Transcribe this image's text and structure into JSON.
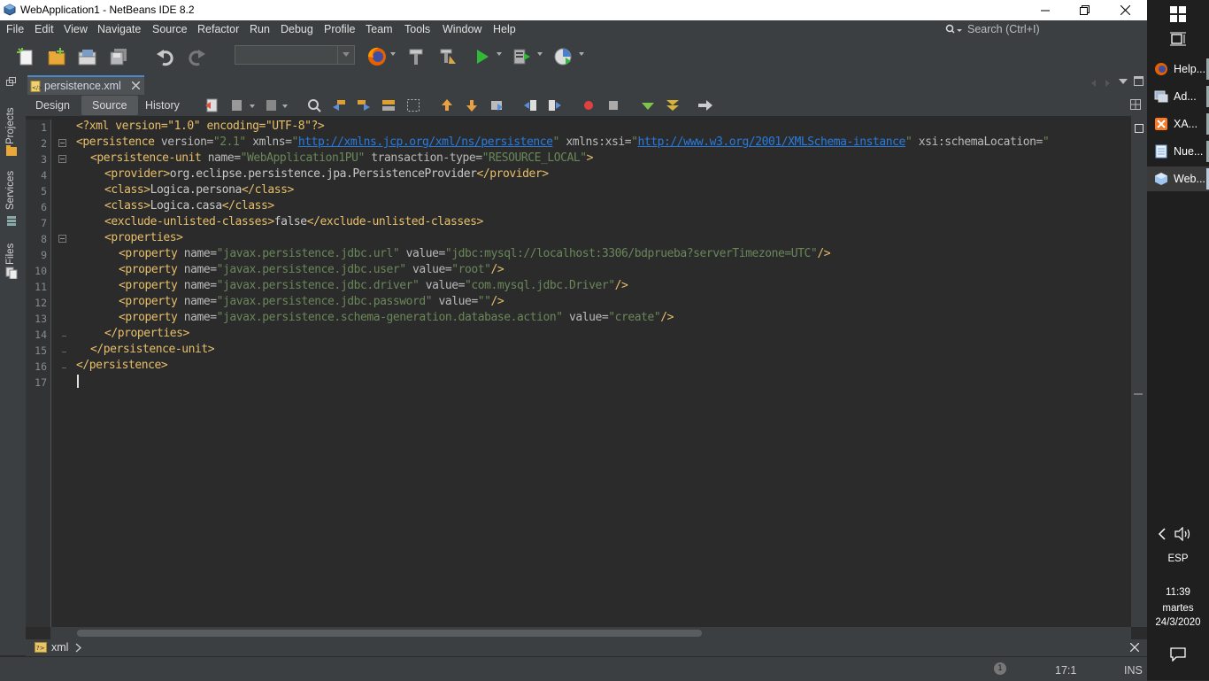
{
  "window": {
    "title": "WebApplication1 - NetBeans IDE 8.2"
  },
  "menu": [
    "File",
    "Edit",
    "View",
    "Navigate",
    "Source",
    "Refactor",
    "Run",
    "Debug",
    "Profile",
    "Team",
    "Tools",
    "Window",
    "Help"
  ],
  "search": {
    "placeholder": "Search (Ctrl+I)"
  },
  "toolbar": {
    "config_value": ""
  },
  "side_tabs": {
    "projects": "Projects",
    "services": "Services",
    "files": "Files"
  },
  "editor_tab": {
    "label": "persistence.xml"
  },
  "editor_modes": {
    "design": "Design",
    "source": "Source",
    "history": "History",
    "active": "Source"
  },
  "line_numbers": [
    "1",
    "2",
    "3",
    "4",
    "5",
    "6",
    "7",
    "8",
    "9",
    "10",
    "11",
    "12",
    "13",
    "14",
    "15",
    "16",
    "17"
  ],
  "code": {
    "l1": {
      "text": "<?xml version=\"1.0\" encoding=\"UTF-8\"?>"
    },
    "l2": {
      "open": "<persistence",
      "a1": " version=",
      "v1": "\"2.1\"",
      "a2": " xmlns=",
      "q": "\"",
      "u1": "http://xmlns.jcp.org/xml/ns/persistence",
      "a3": " xmlns:xsi=",
      "u2": "http://www.w3.org/2001/XMLSchema-instance",
      "a4": " xsi:schemaLocation=",
      "v4": "\""
    },
    "l3": {
      "open": "<persistence-unit",
      "a1": " name=",
      "v1": "\"WebApplication1PU\"",
      "a2": " transaction-type=",
      "v2": "\"RESOURCE_LOCAL\"",
      "close": ">"
    },
    "l4": {
      "open": "<provider>",
      "text": "org.eclipse.persistence.jpa.PersistenceProvider",
      "close": "</provider>"
    },
    "l5": {
      "open": "<class>",
      "text": "Logica.persona",
      "close": "</class>"
    },
    "l6": {
      "open": "<class>",
      "text": "Logica.casa",
      "close": "</class>"
    },
    "l7": {
      "open": "<exclude-unlisted-classes>",
      "text": "false",
      "close": "</exclude-unlisted-classes>"
    },
    "l8": {
      "open": "<properties>"
    },
    "l9": {
      "open": "<property",
      "a1": " name=",
      "v1": "\"javax.persistence.jdbc.url\"",
      "a2": " value=",
      "v2": "\"jdbc:mysql://localhost:3306/bdprueba?serverTimezone=UTC\"",
      "close": "/>"
    },
    "l10": {
      "open": "<property",
      "a1": " name=",
      "v1": "\"javax.persistence.jdbc.user\"",
      "a2": " value=",
      "v2": "\"root\"",
      "close": "/>"
    },
    "l11": {
      "open": "<property",
      "a1": " name=",
      "v1": "\"javax.persistence.jdbc.driver\"",
      "a2": " value=",
      "v2": "\"com.mysql.jdbc.Driver\"",
      "close": "/>"
    },
    "l12": {
      "open": "<property",
      "a1": " name=",
      "v1": "\"javax.persistence.jdbc.password\"",
      "a2": " value=",
      "v2": "\"\"",
      "close": "/>"
    },
    "l13": {
      "open": "<property",
      "a1": " name=",
      "v1": "\"javax.persistence.schema-generation.database.action\"",
      "a2": " value=",
      "v2": "\"create\"",
      "close": "/>"
    },
    "l14": {
      "close": "</properties>"
    },
    "l15": {
      "close": "</persistence-unit>"
    },
    "l16": {
      "close": "</persistence>"
    },
    "l17": {
      "text": ""
    }
  },
  "breadcrumb": {
    "label": "xml"
  },
  "status": {
    "notifications": "1",
    "position": "17:1",
    "mode": "INS"
  },
  "taskbar": {
    "apps": [
      "Help...",
      "Ad...",
      "XA...",
      "Nue...",
      "Web..."
    ],
    "language": "ESP",
    "time": "11:39",
    "day": "martes",
    "date": "24/3/2020"
  },
  "colors": {
    "tag": "#e8bf6a",
    "attr": "#bababa",
    "value": "#6a8759",
    "url": "#287bde",
    "background": "#2b2b2b",
    "chrome": "#3c3f41"
  }
}
